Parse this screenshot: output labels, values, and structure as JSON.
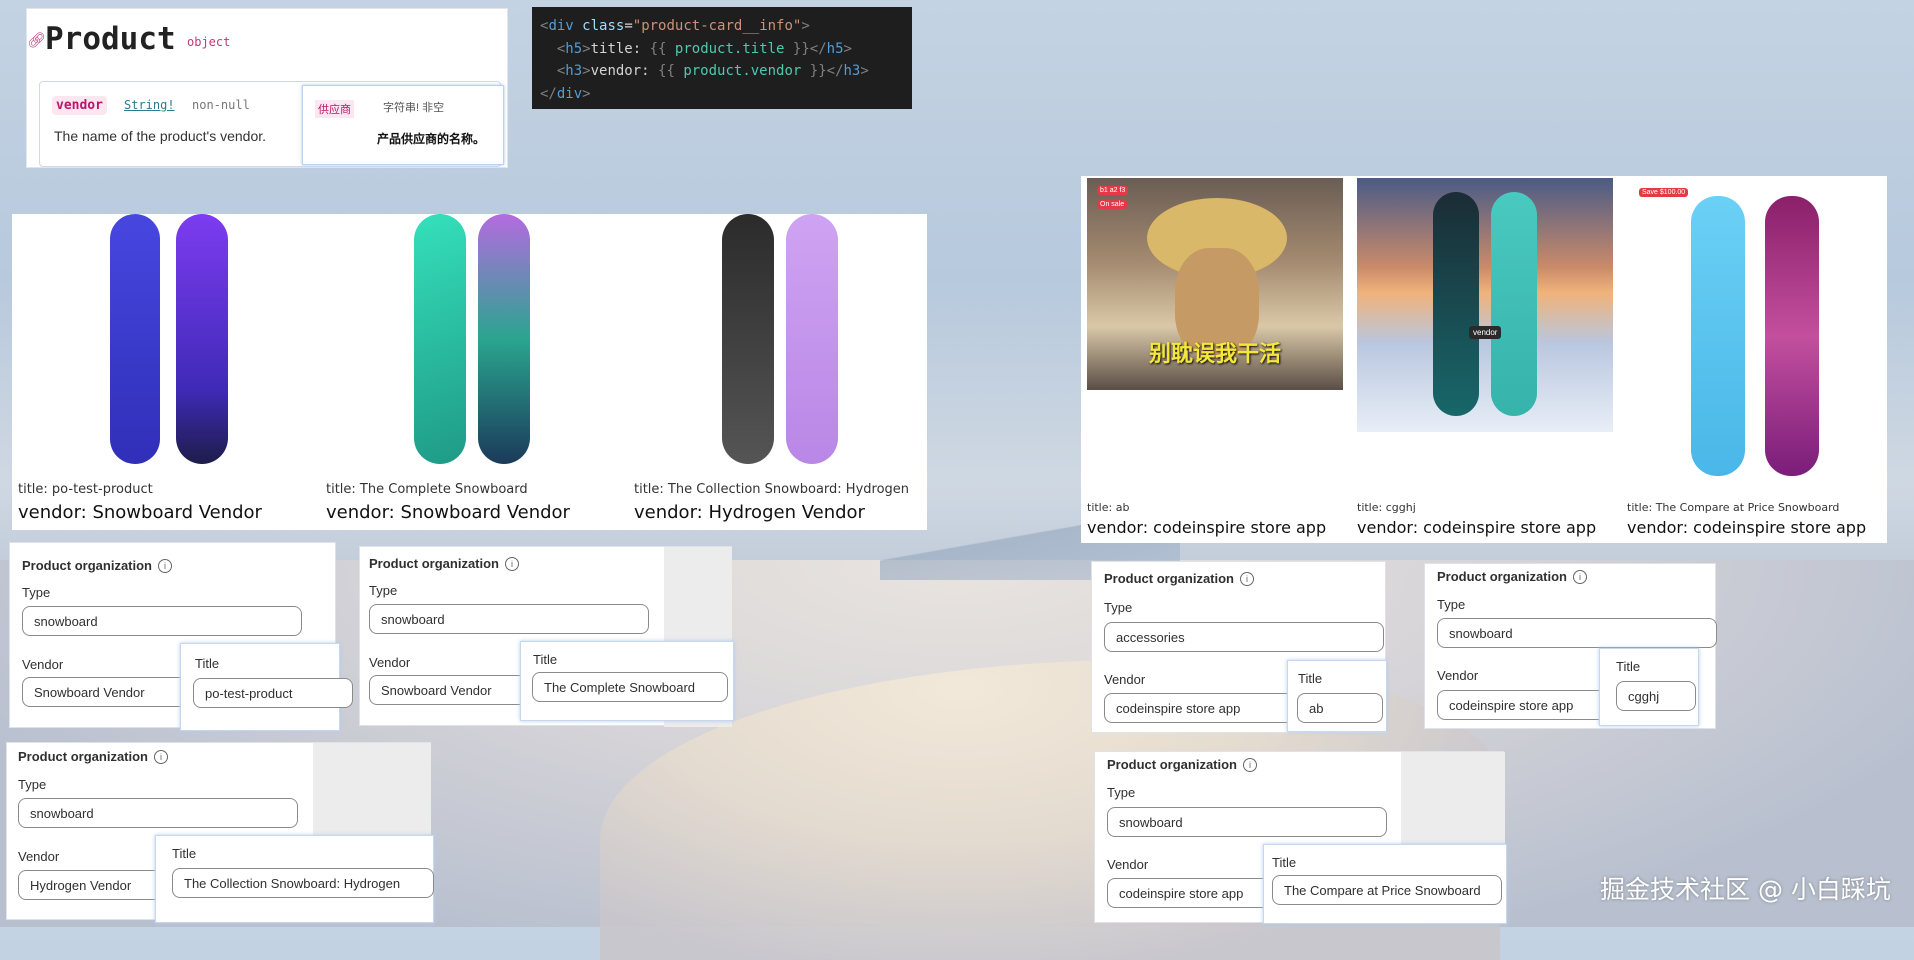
{
  "doc": {
    "title": "Product",
    "object_tag": "object",
    "field_name": "vendor",
    "field_type": "String!",
    "field_null": "non-null",
    "field_desc": "The name of the product's vendor.",
    "zh_name": "供应商",
    "zh_type": "字符串! 非空",
    "zh_desc": "产品供应商的名称。"
  },
  "code": {
    "lines": [
      "<div class=\"product-card__info\">",
      "  <h5>title: {{ product.title }}</h5>",
      "  <h3>vendor: {{ product.vendor }}</h3>",
      "</div>"
    ]
  },
  "cards_row1": [
    {
      "title": "title: po-test-product",
      "vendor": "vendor: Snowboard Vendor",
      "colors": [
        "#3f3fd4",
        "#5b2bd0"
      ]
    },
    {
      "title": "title: The Complete Snowboard",
      "vendor": "vendor: Snowboard Vendor",
      "colors": [
        "#2fc6a6",
        "#2a7f8a"
      ]
    },
    {
      "title": "title: The Collection Snowboard: Hydrogen",
      "vendor": "vendor: Hydrogen Vendor",
      "colors": [
        "#3a3a3a",
        "#c9a0ef"
      ]
    }
  ],
  "cards_row2": [
    {
      "title": "title: ab",
      "vendor": "vendor: codeinspire store app",
      "badge1": "b1 a2 f3",
      "badge2": "On sale",
      "caption": "别耽误我干活"
    },
    {
      "title": "title: cgghj",
      "vendor": "vendor: codeinspire store app",
      "label": "vendor"
    },
    {
      "title": "title: The Compare at Price Snowboard",
      "vendor": "vendor: codeinspire store app",
      "badge1": "Save $100.00"
    }
  ],
  "orgs": [
    {
      "heading": "Product organization",
      "type_label": "Type",
      "type_value": "snowboard",
      "vendor_label": "Vendor",
      "vendor_value": "Snowboard Vendor",
      "title_label": "Title",
      "title_value": "po-test-product"
    },
    {
      "heading": "Product organization",
      "type_label": "Type",
      "type_value": "snowboard",
      "vendor_label": "Vendor",
      "vendor_value": "Snowboard Vendor",
      "title_label": "Title",
      "title_value": "The Complete Snowboard"
    },
    {
      "heading": "Product organization",
      "type_label": "Type",
      "type_value": "snowboard",
      "vendor_label": "Vendor",
      "vendor_value": "Hydrogen Vendor",
      "title_label": "Title",
      "title_value": "The Collection Snowboard: Hydrogen"
    },
    {
      "heading": "Product organization",
      "type_label": "Type",
      "type_value": "accessories",
      "vendor_label": "Vendor",
      "vendor_value": "codeinspire store app",
      "title_label": "Title",
      "title_value": "ab"
    },
    {
      "heading": "Product organization",
      "type_label": "Type",
      "type_value": "snowboard",
      "vendor_label": "Vendor",
      "vendor_value": "codeinspire store app",
      "title_label": "Title",
      "title_value": "cgghj"
    },
    {
      "heading": "Product organization",
      "type_label": "Type",
      "type_value": "snowboard",
      "vendor_label": "Vendor",
      "vendor_value": "codeinspire store app",
      "title_label": "Title",
      "title_value": "The Compare at Price Snowboard"
    }
  ],
  "watermark": "掘金技术社区 @ 小白踩坑"
}
